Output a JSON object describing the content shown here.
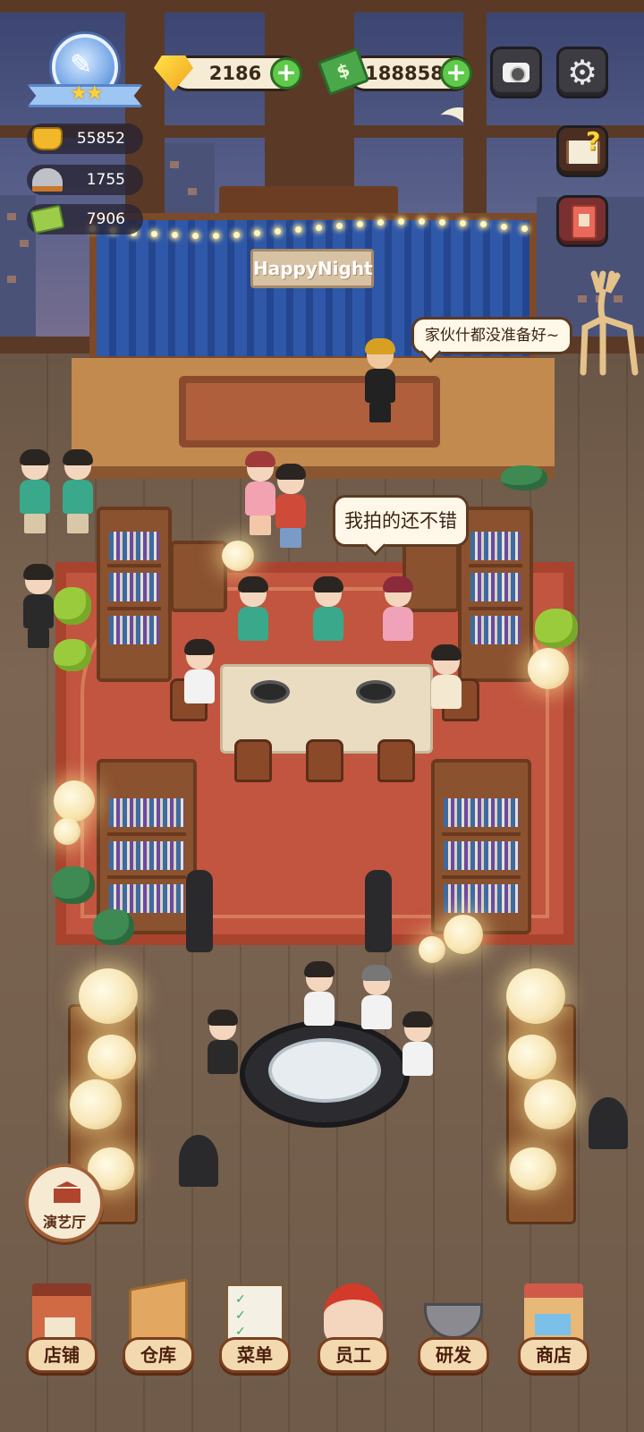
{
  "stage": {
    "sign": "HappyNight"
  },
  "speech": {
    "performer": "家伙什都没准备好~",
    "guest": "我拍的还不错"
  },
  "resources": {
    "gems": "2186",
    "cash": "188858"
  },
  "stats": {
    "gold": "55852",
    "dishes": "1755",
    "recipes": "7906"
  },
  "restaurant_level": {
    "stars": "★★"
  },
  "icons": {
    "gems": "gem-icon",
    "cash": "cash-icon",
    "camera": "camera-icon",
    "settings": "gear-icon",
    "guide": "guide-book-icon",
    "diary": "diary-icon",
    "gold": "gold-ingot-icon",
    "dishes": "cloche-icon",
    "recipes": "recipe-card-icon",
    "hall": "temple-icon"
  },
  "hall_button": {
    "label": "演艺厅"
  },
  "nav": [
    {
      "label": "店铺",
      "icon": "shop-icon"
    },
    {
      "label": "仓库",
      "icon": "warehouse-icon"
    },
    {
      "label": "菜单",
      "icon": "menu-icon"
    },
    {
      "label": "员工",
      "icon": "staff-icon"
    },
    {
      "label": "研发",
      "icon": "research-icon"
    },
    {
      "label": "商店",
      "icon": "store-icon"
    }
  ]
}
